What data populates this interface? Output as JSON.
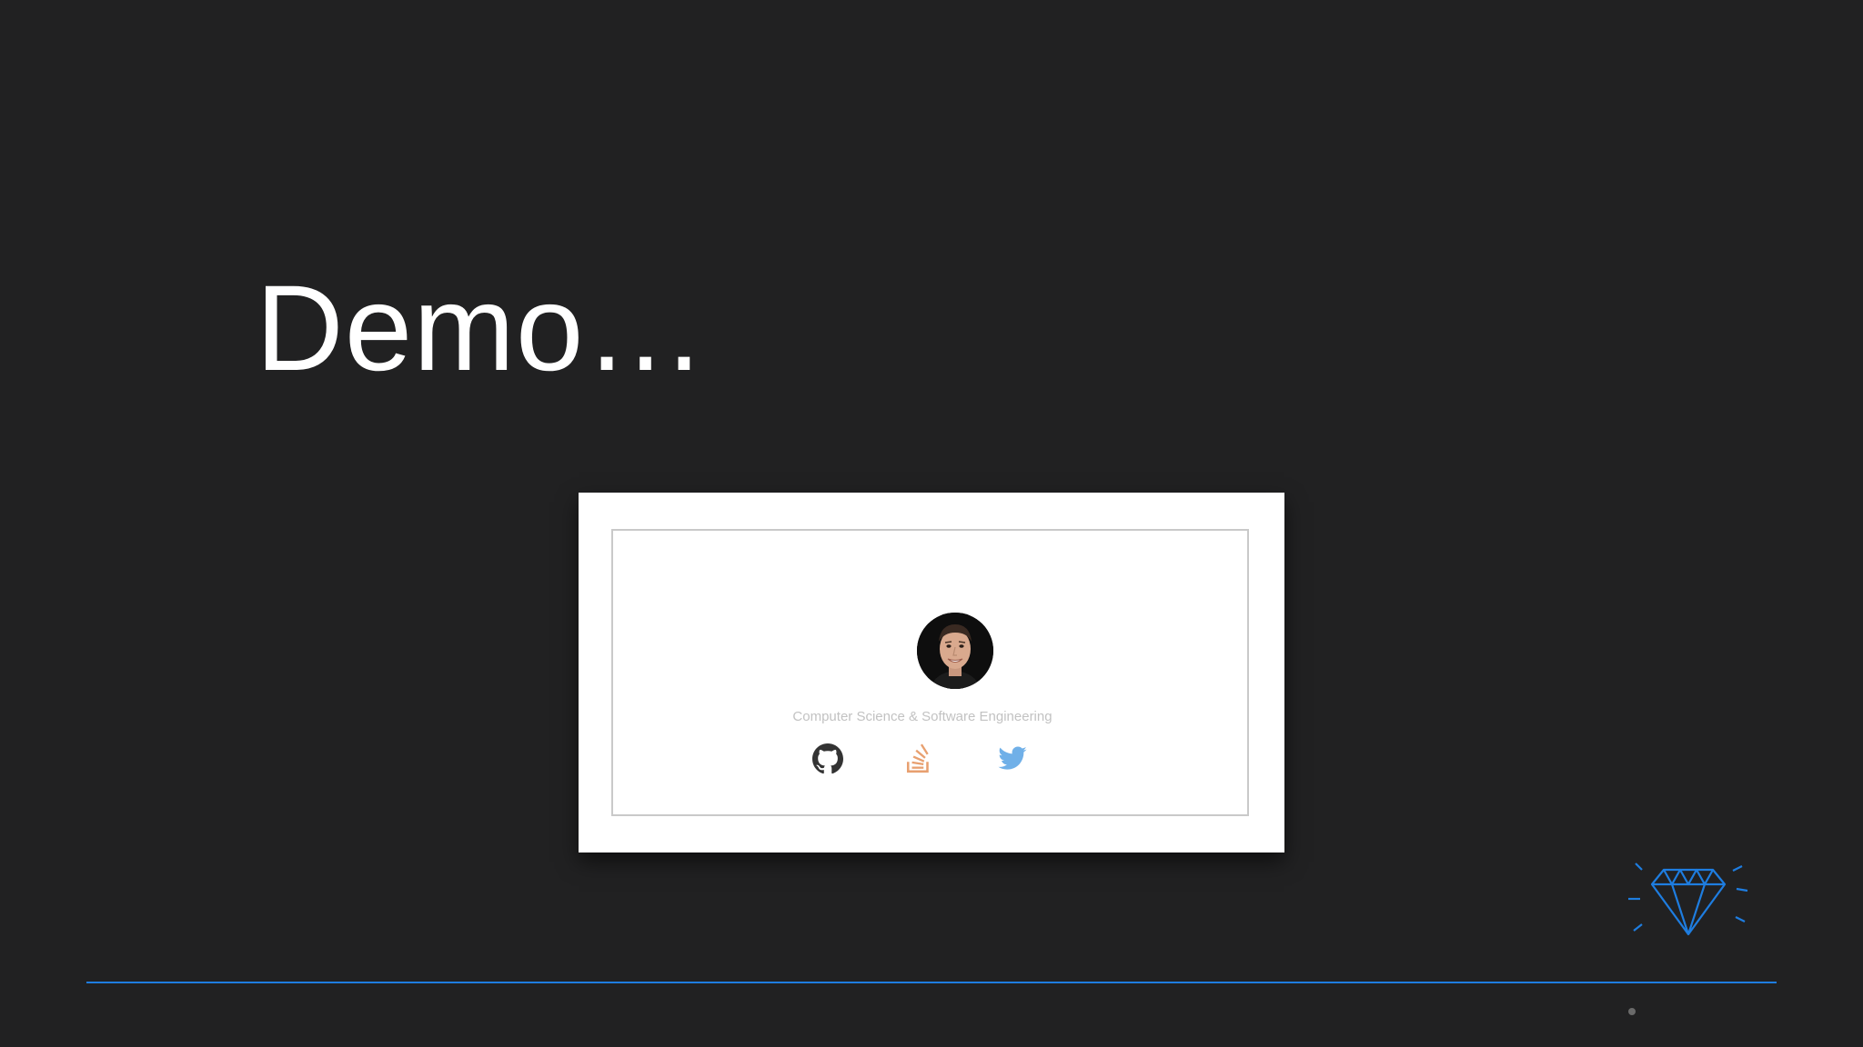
{
  "slide": {
    "title": "Demo…",
    "accent_color": "#1e7de0",
    "background_color": "#212122"
  },
  "profile_card": {
    "tagline": "Computer Science & Software Engineering",
    "avatar": "profile-photo",
    "links": [
      {
        "name": "github",
        "icon": "github-icon",
        "color": "#333333"
      },
      {
        "name": "stackoverflow",
        "icon": "stackoverflow-icon",
        "color": "#e8a070"
      },
      {
        "name": "twitter",
        "icon": "twitter-icon",
        "color": "#70b0e8"
      }
    ]
  },
  "decoration": {
    "icon": "diamond-icon"
  }
}
